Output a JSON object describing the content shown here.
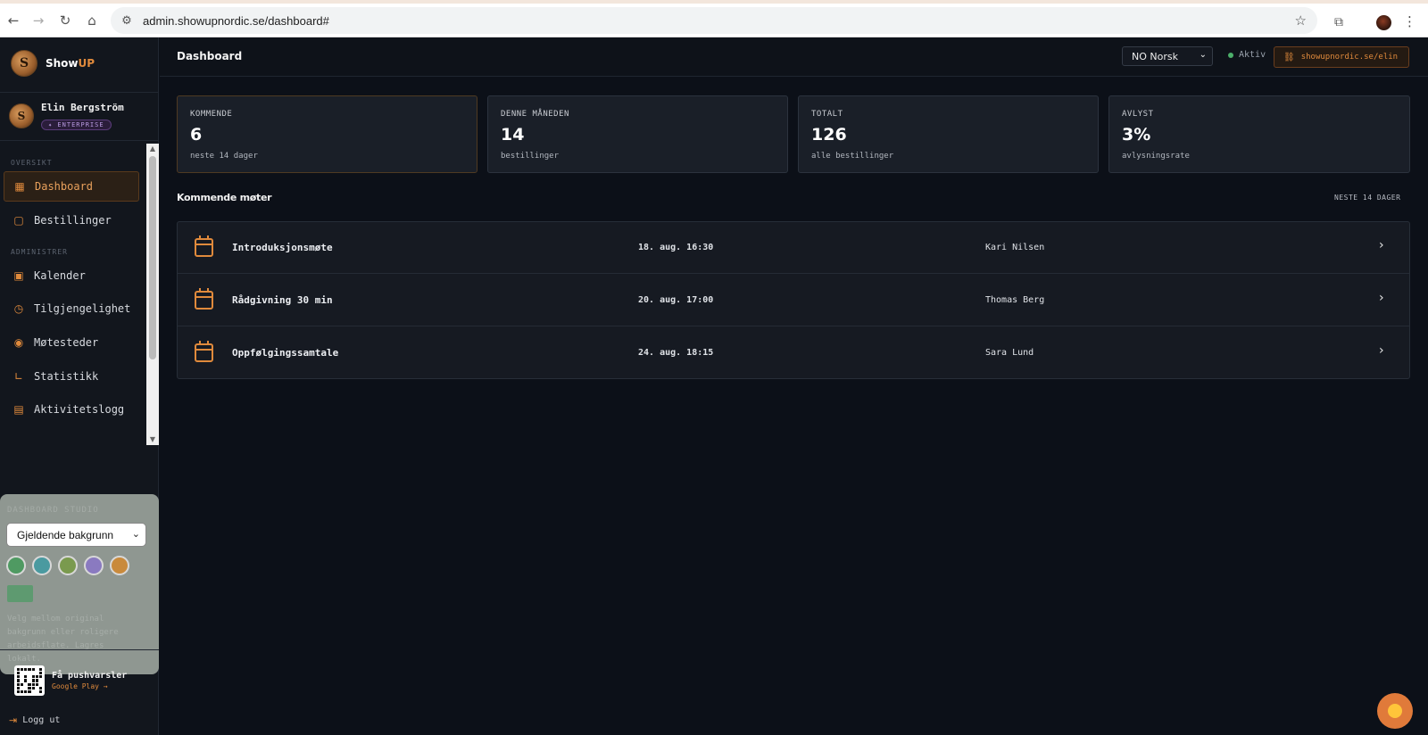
{
  "browser": {
    "url": "admin.showupnordic.se/dashboard#"
  },
  "sidebar": {
    "brand": {
      "name_prefix": "Show",
      "name_suffix": "UP",
      "logo_letter": "S"
    },
    "user": {
      "name": "Elin Bergström",
      "plan": "✦ ENTERPRISE",
      "avatar_letter": "S"
    },
    "sections": {
      "overview": "OVERSIKT",
      "admin": "ADMINISTRER"
    },
    "items": [
      {
        "label": "Dashboard",
        "icon": "grid-icon"
      },
      {
        "label": "Bestillinger",
        "icon": "square-icon"
      },
      {
        "label": "Kalender",
        "icon": "calendar-icon"
      },
      {
        "label": "Tilgjengelighet",
        "icon": "clock-icon"
      },
      {
        "label": "Møtesteder",
        "icon": "map-pin-icon"
      },
      {
        "label": "Statistikk",
        "icon": "chart-icon"
      },
      {
        "label": "Aktivitetslogg",
        "icon": "log-icon"
      }
    ],
    "studio": {
      "title": "DASHBOARD STUDIO",
      "select_value": "Gjeldende bakgrunn",
      "swatches": [
        "#4f9a62",
        "#4a9aa0",
        "#7a9a4e",
        "#8a7ac0",
        "#c98a3c"
      ],
      "hint": "Velg mellom original bakgrunn eller roligere arbeidsflate. Lagres lokalt."
    },
    "push": {
      "title": "Få pushvarsler",
      "subtitle": "Google Play →"
    },
    "logout": "Logg ut"
  },
  "header": {
    "title": "Dashboard",
    "language": "NO Norsk",
    "status": "Aktiv",
    "link": "showupnordic.se/elin"
  },
  "stats": [
    {
      "label": "KOMMENDE",
      "value": "6",
      "sub": "neste 14 dager"
    },
    {
      "label": "DENNE MÅNEDEN",
      "value": "14",
      "sub": "bestillinger"
    },
    {
      "label": "TOTALT",
      "value": "126",
      "sub": "alle bestillinger"
    },
    {
      "label": "AVLYST",
      "value": "3%",
      "sub": "avlysningsrate"
    }
  ],
  "upcoming": {
    "title": "Kommende møter",
    "range": "NESTE 14 DAGER",
    "meetings": [
      {
        "title": "Introduksjonsmøte",
        "time": "18. aug. 16:30",
        "person": "Kari Nilsen"
      },
      {
        "title": "Rådgivning 30 min",
        "time": "20. aug. 17:00",
        "person": "Thomas Berg"
      },
      {
        "title": "Oppfølgingssamtale",
        "time": "24. aug. 18:15",
        "person": "Sara Lund"
      }
    ]
  },
  "colors": {
    "accent": "#e08a3c",
    "background": "#0c1018",
    "card": "#1a1f28",
    "active_status": "#4caf6a"
  }
}
